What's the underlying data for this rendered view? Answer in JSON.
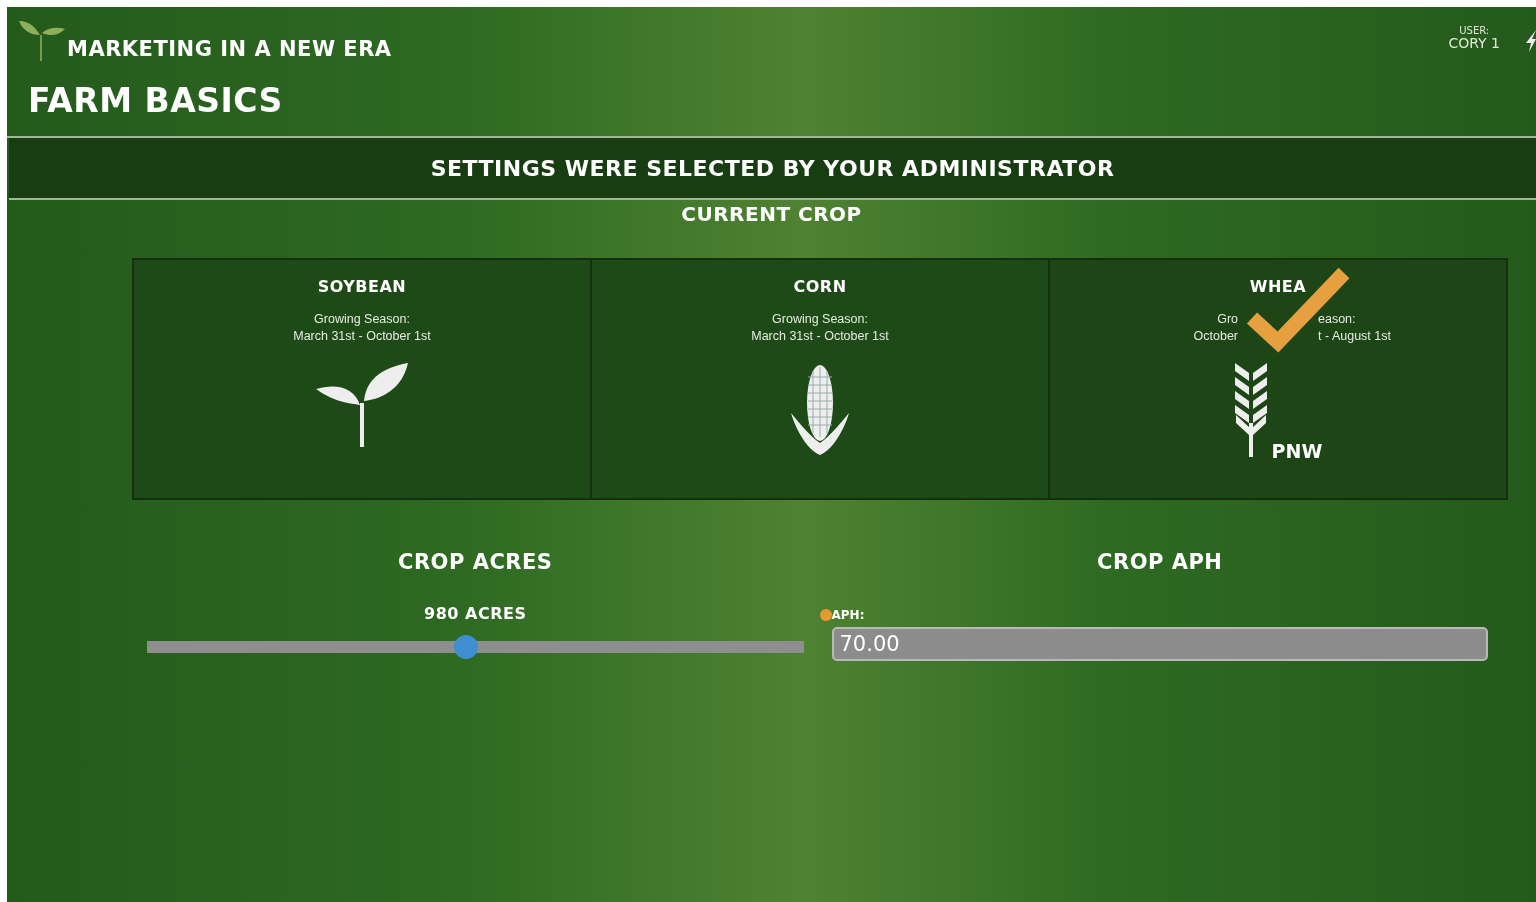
{
  "header": {
    "brand": "MARKETING IN A NEW ERA",
    "title": "FARM BASICS",
    "user_label": "USER:",
    "user_name": "CORY 1"
  },
  "banner": "SETTINGS WERE SELECTED BY YOUR ADMINISTRATOR",
  "crop_section": {
    "title": "CURRENT CROP",
    "crops": [
      {
        "kind": "sprout",
        "name": "SOYBEAN",
        "season_label": [
          "Growing Season:"
        ],
        "season_dates": [
          "March 31st - October 1st"
        ],
        "selected": false
      },
      {
        "kind": "corn",
        "name": "CORN",
        "season_label": [
          "Growing Season:"
        ],
        "season_dates": [
          "March 31st - October 1st"
        ],
        "selected": false
      },
      {
        "kind": "wheat",
        "name": "WHEA",
        "season_label": [
          "Gro",
          "eason:"
        ],
        "season_dates": [
          "October",
          "t - August 1st"
        ],
        "selected": true,
        "tag": "PNW"
      }
    ]
  },
  "acres": {
    "title": "CROP ACRES",
    "reading": "980 ACRES",
    "level": 0.485
  },
  "aph": {
    "title": "CROP APH",
    "label": "APH:",
    "value": "70.00"
  }
}
